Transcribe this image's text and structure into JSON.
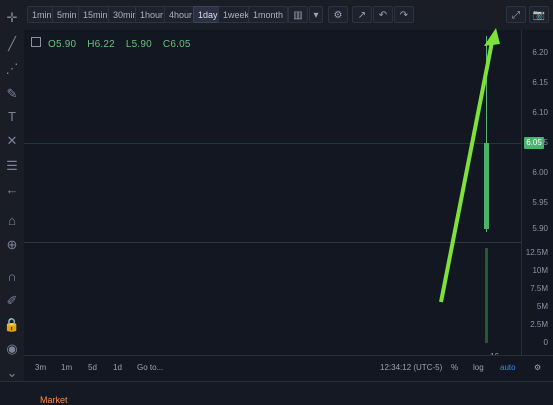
{
  "toolbar": {
    "timeframes": [
      "1min",
      "5min",
      "15min",
      "30min",
      "1hour",
      "4hour",
      "1day",
      "1week",
      "1month"
    ],
    "active_timeframe": "1day"
  },
  "ohlc": {
    "open": "O5.90",
    "high": "H6.22",
    "low": "L5.90",
    "close": "C6.05"
  },
  "price_axis": {
    "labels": [
      "6.20",
      "6.15",
      "6.10",
      "6.05",
      "6.00",
      "5.95",
      "5.90"
    ],
    "current_price": "6.05"
  },
  "volume_axis": {
    "labels": [
      "12.5M",
      "10M",
      "7.5M",
      "5M",
      "2.5M",
      "0"
    ]
  },
  "footer": {
    "range_buttons": [
      "3m",
      "1m",
      "5d",
      "1d",
      "Go to..."
    ],
    "time": "12:34:12 (UTC-5)",
    "pct": "%",
    "log": "log",
    "auto": "auto"
  },
  "x_axis": {
    "date": "16"
  },
  "bottom": {
    "text": "Market"
  },
  "colors": {
    "up": "#49b36e",
    "accent_arrow": "#7ee23a",
    "auto": "#2f8cff"
  }
}
